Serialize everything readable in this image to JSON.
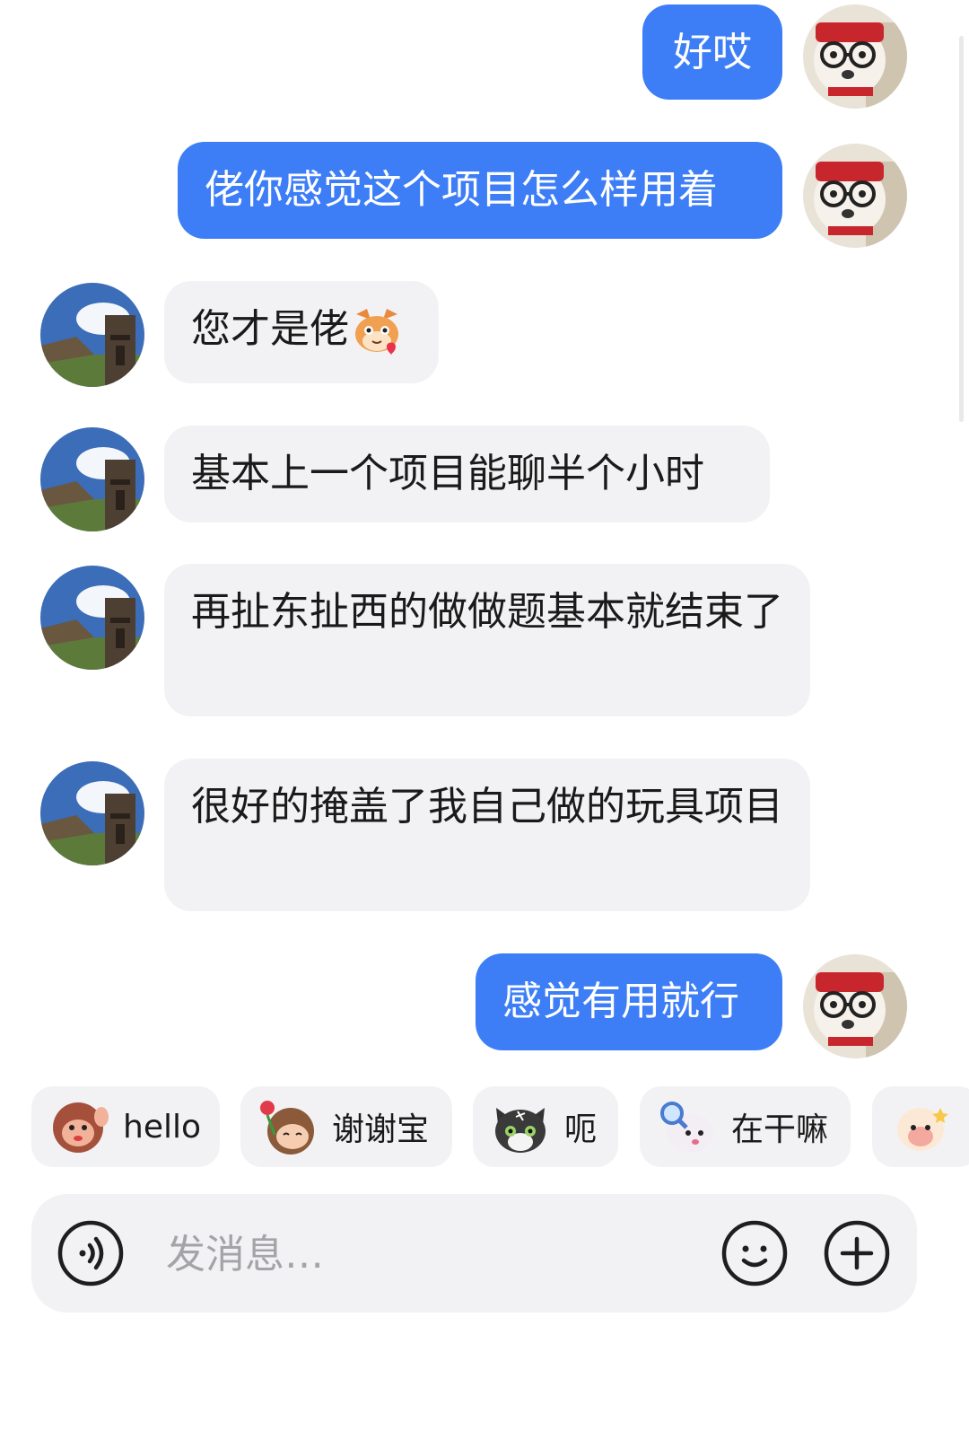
{
  "messages": [
    {
      "side": "out",
      "text": "好哎"
    },
    {
      "side": "out",
      "text": "佬你感觉这个项目怎么样用着"
    },
    {
      "side": "in",
      "text": "您才是佬",
      "emoji": "cat-heart-emoji"
    },
    {
      "side": "in",
      "text": "基本上一个项目能聊半个小时"
    },
    {
      "side": "in",
      "text": "再扯东扯西的做做题基本就结束了"
    },
    {
      "side": "in",
      "text": "很好的掩盖了我自己做的玩具项目"
    },
    {
      "side": "out",
      "text": "感觉有用就行"
    }
  ],
  "quick_stickers": [
    {
      "label": "hello",
      "icon": "waving-monkey-sticker"
    },
    {
      "label": "谢谢宝",
      "icon": "girl-with-rose-sticker"
    },
    {
      "label": "呃",
      "icon": "cat-face-sticker"
    },
    {
      "label": "在干嘛",
      "icon": "magnifier-sheep-sticker"
    },
    {
      "label": "",
      "icon": "sheep-sticker"
    }
  ],
  "composer": {
    "placeholder": "发消息…",
    "voice_icon": "voice-icon",
    "emoji_icon": "smile-icon",
    "plus_icon": "plus-icon"
  },
  "colors": {
    "outgoing_bubble": "#3d7ef7",
    "incoming_bubble": "#f2f2f4",
    "background": "#ffffff"
  }
}
